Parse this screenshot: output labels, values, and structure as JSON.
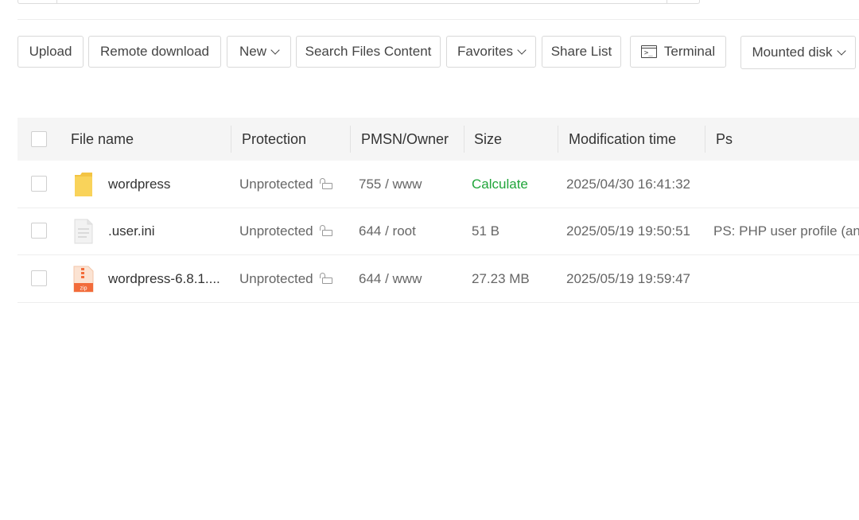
{
  "toolbar": {
    "upload": "Upload",
    "remote_download": "Remote download",
    "new": "New",
    "search_files_content": "Search Files Content",
    "favorites": "Favorites",
    "share_list": "Share List",
    "terminal": "Terminal",
    "mounted_disk": "Mounted disk"
  },
  "table": {
    "headers": {
      "file_name": "File name",
      "protection": "Protection",
      "pmsn_owner": "PMSN/Owner",
      "size": "Size",
      "modification_time": "Modification time",
      "ps": "Ps"
    },
    "rows": [
      {
        "icon": "folder-icon",
        "name": "wordpress",
        "protection": "Unprotected",
        "pmsn_owner": "755 / www",
        "size": "Calculate",
        "modified": "2025/04/30 16:41:32",
        "ps": ""
      },
      {
        "icon": "text-file-icon",
        "name": ".user.ini",
        "protection": "Unprotected",
        "pmsn_owner": "644 / root",
        "size": "51 B",
        "modified": "2025/05/19 19:50:51",
        "ps": "PS: PHP user profile (an"
      },
      {
        "icon": "zip-file-icon",
        "name": "wordpress-6.8.1....",
        "protection": "Unprotected",
        "pmsn_owner": "644 / www",
        "size": "27.23 MB",
        "modified": "2025/05/19 19:59:47",
        "ps": ""
      }
    ]
  },
  "colors": {
    "accent_green": "#20a53a",
    "header_bg": "#f5f5f5",
    "folder_yellow": "#f9d35a",
    "zip_orange": "#f26b3a"
  }
}
